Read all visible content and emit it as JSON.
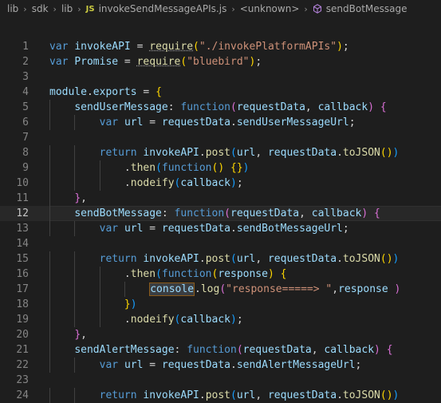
{
  "breadcrumb": {
    "segments": [
      "lib",
      "sdk",
      "lib"
    ],
    "file_badge": "JS",
    "file": "invokeSendMessageAPIs.js",
    "scope": "<unknown>",
    "symbol": "sendBotMessage"
  },
  "editor": {
    "active_line": 12,
    "line_numbers": [
      "1",
      "2",
      "3",
      "4",
      "5",
      "6",
      "7",
      "8",
      "9",
      "10",
      "11",
      "12",
      "13",
      "14",
      "15",
      "16",
      "17",
      "18",
      "19",
      "20",
      "21",
      "22",
      "23",
      "24"
    ],
    "lines": [
      [
        {
          "t": "var ",
          "c": "k"
        },
        {
          "t": "invokeAPI",
          "c": "v"
        },
        {
          "t": " = ",
          "c": "t"
        },
        {
          "t": "require",
          "c": "f"
        },
        {
          "t": "(",
          "c": "b1"
        },
        {
          "t": "\"./invokePlatformAPIs\"",
          "c": "s"
        },
        {
          "t": ")",
          "c": "b1"
        },
        {
          "t": ";",
          "c": "t"
        }
      ],
      [
        {
          "t": "var ",
          "c": "k"
        },
        {
          "t": "Promise",
          "c": "v"
        },
        {
          "t": " = ",
          "c": "t"
        },
        {
          "t": "require",
          "c": "f"
        },
        {
          "t": "(",
          "c": "b1"
        },
        {
          "t": "\"bluebird\"",
          "c": "s"
        },
        {
          "t": ")",
          "c": "b1"
        },
        {
          "t": ";",
          "c": "t"
        }
      ],
      [],
      [
        {
          "t": "module",
          "c": "v"
        },
        {
          "t": ".",
          "c": "t"
        },
        {
          "t": "exports",
          "c": "v"
        },
        {
          "t": " = ",
          "c": "t"
        },
        {
          "t": "{",
          "c": "b1"
        }
      ],
      [
        {
          "t": "    ",
          "c": "t"
        },
        {
          "t": "sendUserMessage",
          "c": "v"
        },
        {
          "t": ": ",
          "c": "t"
        },
        {
          "t": "function",
          "c": "k"
        },
        {
          "t": "(",
          "c": "b2"
        },
        {
          "t": "requestData",
          "c": "v"
        },
        {
          "t": ", ",
          "c": "t"
        },
        {
          "t": "callback",
          "c": "v"
        },
        {
          "t": ")",
          "c": "b2"
        },
        {
          "t": " ",
          "c": "t"
        },
        {
          "t": "{",
          "c": "b2"
        }
      ],
      [
        {
          "t": "        ",
          "c": "t"
        },
        {
          "t": "var ",
          "c": "k"
        },
        {
          "t": "url",
          "c": "v"
        },
        {
          "t": " = ",
          "c": "t"
        },
        {
          "t": "requestData",
          "c": "v"
        },
        {
          "t": ".",
          "c": "t"
        },
        {
          "t": "sendUserMessageUrl",
          "c": "v"
        },
        {
          "t": ";",
          "c": "t"
        }
      ],
      [],
      [
        {
          "t": "        ",
          "c": "t"
        },
        {
          "t": "return ",
          "c": "k"
        },
        {
          "t": "invokeAPI",
          "c": "v"
        },
        {
          "t": ".",
          "c": "t"
        },
        {
          "t": "post",
          "c": "f"
        },
        {
          "t": "(",
          "c": "b3"
        },
        {
          "t": "url",
          "c": "v"
        },
        {
          "t": ", ",
          "c": "t"
        },
        {
          "t": "requestData",
          "c": "v"
        },
        {
          "t": ".",
          "c": "t"
        },
        {
          "t": "toJSON",
          "c": "f"
        },
        {
          "t": "()",
          "c": "b1"
        },
        {
          "t": ")",
          "c": "b3"
        }
      ],
      [
        {
          "t": "            ",
          "c": "t"
        },
        {
          "t": ".",
          "c": "t"
        },
        {
          "t": "then",
          "c": "f"
        },
        {
          "t": "(",
          "c": "b3"
        },
        {
          "t": "function",
          "c": "k"
        },
        {
          "t": "()",
          "c": "b1"
        },
        {
          "t": " ",
          "c": "t"
        },
        {
          "t": "{}",
          "c": "b1"
        },
        {
          "t": ")",
          "c": "b3"
        }
      ],
      [
        {
          "t": "            ",
          "c": "t"
        },
        {
          "t": ".",
          "c": "t"
        },
        {
          "t": "nodeify",
          "c": "f"
        },
        {
          "t": "(",
          "c": "b3"
        },
        {
          "t": "callback",
          "c": "v"
        },
        {
          "t": ")",
          "c": "b3"
        },
        {
          "t": ";",
          "c": "t"
        }
      ],
      [
        {
          "t": "    ",
          "c": "t"
        },
        {
          "t": "}",
          "c": "b2"
        },
        {
          "t": ",",
          "c": "t"
        }
      ],
      [
        {
          "t": "    ",
          "c": "t"
        },
        {
          "t": "sendBotMessage",
          "c": "v"
        },
        {
          "t": ": ",
          "c": "t"
        },
        {
          "t": "function",
          "c": "k"
        },
        {
          "t": "(",
          "c": "b2"
        },
        {
          "t": "requestData",
          "c": "v"
        },
        {
          "t": ", ",
          "c": "t"
        },
        {
          "t": "callback",
          "c": "v"
        },
        {
          "t": ")",
          "c": "b2"
        },
        {
          "t": " ",
          "c": "t"
        },
        {
          "t": "{",
          "c": "b2"
        }
      ],
      [
        {
          "t": "        ",
          "c": "t"
        },
        {
          "t": "var ",
          "c": "k"
        },
        {
          "t": "url",
          "c": "v"
        },
        {
          "t": " = ",
          "c": "t"
        },
        {
          "t": "requestData",
          "c": "v"
        },
        {
          "t": ".",
          "c": "t"
        },
        {
          "t": "sendBotMessageUrl",
          "c": "v"
        },
        {
          "t": ";",
          "c": "t"
        }
      ],
      [],
      [
        {
          "t": "        ",
          "c": "t"
        },
        {
          "t": "return ",
          "c": "k"
        },
        {
          "t": "invokeAPI",
          "c": "v"
        },
        {
          "t": ".",
          "c": "t"
        },
        {
          "t": "post",
          "c": "f"
        },
        {
          "t": "(",
          "c": "b3"
        },
        {
          "t": "url",
          "c": "v"
        },
        {
          "t": ", ",
          "c": "t"
        },
        {
          "t": "requestData",
          "c": "v"
        },
        {
          "t": ".",
          "c": "t"
        },
        {
          "t": "toJSON",
          "c": "f"
        },
        {
          "t": "()",
          "c": "b1"
        },
        {
          "t": ")",
          "c": "b3"
        }
      ],
      [
        {
          "t": "            ",
          "c": "t"
        },
        {
          "t": ".",
          "c": "t"
        },
        {
          "t": "then",
          "c": "f"
        },
        {
          "t": "(",
          "c": "b3"
        },
        {
          "t": "function",
          "c": "k"
        },
        {
          "t": "(",
          "c": "b1"
        },
        {
          "t": "response",
          "c": "v"
        },
        {
          "t": ")",
          "c": "b1"
        },
        {
          "t": " ",
          "c": "t"
        },
        {
          "t": "{",
          "c": "b1"
        }
      ],
      [
        {
          "t": "                ",
          "c": "t"
        },
        {
          "t": "console",
          "c": "v",
          "hl": true
        },
        {
          "t": ".",
          "c": "t"
        },
        {
          "t": "log",
          "c": "f"
        },
        {
          "t": "(",
          "c": "b2"
        },
        {
          "t": "\"response=====> \"",
          "c": "s"
        },
        {
          "t": ",",
          "c": "t"
        },
        {
          "t": "response",
          "c": "v"
        },
        {
          "t": " ",
          "c": "t"
        },
        {
          "t": ")",
          "c": "b2"
        }
      ],
      [
        {
          "t": "            ",
          "c": "t"
        },
        {
          "t": "}",
          "c": "b1"
        },
        {
          "t": ")",
          "c": "b3"
        }
      ],
      [
        {
          "t": "            ",
          "c": "t"
        },
        {
          "t": ".",
          "c": "t"
        },
        {
          "t": "nodeify",
          "c": "f"
        },
        {
          "t": "(",
          "c": "b3"
        },
        {
          "t": "callback",
          "c": "v"
        },
        {
          "t": ")",
          "c": "b3"
        },
        {
          "t": ";",
          "c": "t"
        }
      ],
      [
        {
          "t": "    ",
          "c": "t"
        },
        {
          "t": "}",
          "c": "b2"
        },
        {
          "t": ",",
          "c": "t"
        }
      ],
      [
        {
          "t": "    ",
          "c": "t"
        },
        {
          "t": "sendAlertMessage",
          "c": "v"
        },
        {
          "t": ": ",
          "c": "t"
        },
        {
          "t": "function",
          "c": "k"
        },
        {
          "t": "(",
          "c": "b2"
        },
        {
          "t": "requestData",
          "c": "v"
        },
        {
          "t": ", ",
          "c": "t"
        },
        {
          "t": "callback",
          "c": "v"
        },
        {
          "t": ")",
          "c": "b2"
        },
        {
          "t": " ",
          "c": "t"
        },
        {
          "t": "{",
          "c": "b2"
        }
      ],
      [
        {
          "t": "        ",
          "c": "t"
        },
        {
          "t": "var ",
          "c": "k"
        },
        {
          "t": "url",
          "c": "v"
        },
        {
          "t": " = ",
          "c": "t"
        },
        {
          "t": "requestData",
          "c": "v"
        },
        {
          "t": ".",
          "c": "t"
        },
        {
          "t": "sendAlertMessageUrl",
          "c": "v"
        },
        {
          "t": ";",
          "c": "t"
        }
      ],
      [],
      [
        {
          "t": "        ",
          "c": "t"
        },
        {
          "t": "return ",
          "c": "k"
        },
        {
          "t": "invokeAPI",
          "c": "v"
        },
        {
          "t": ".",
          "c": "t"
        },
        {
          "t": "post",
          "c": "f"
        },
        {
          "t": "(",
          "c": "b3"
        },
        {
          "t": "url",
          "c": "v"
        },
        {
          "t": ", ",
          "c": "t"
        },
        {
          "t": "requestData",
          "c": "v"
        },
        {
          "t": ".",
          "c": "t"
        },
        {
          "t": "toJSON",
          "c": "f"
        },
        {
          "t": "()",
          "c": "b1"
        },
        {
          "t": ")",
          "c": "b3"
        }
      ]
    ]
  },
  "colors": {
    "background": "#1e1e1e",
    "keyword": "#569cd6",
    "variable": "#9cdcfe",
    "string": "#ce9178",
    "function": "#dcdcaa",
    "bracket_gold": "#ffd700",
    "bracket_orchid": "#da70d6",
    "bracket_blue": "#179fff"
  }
}
